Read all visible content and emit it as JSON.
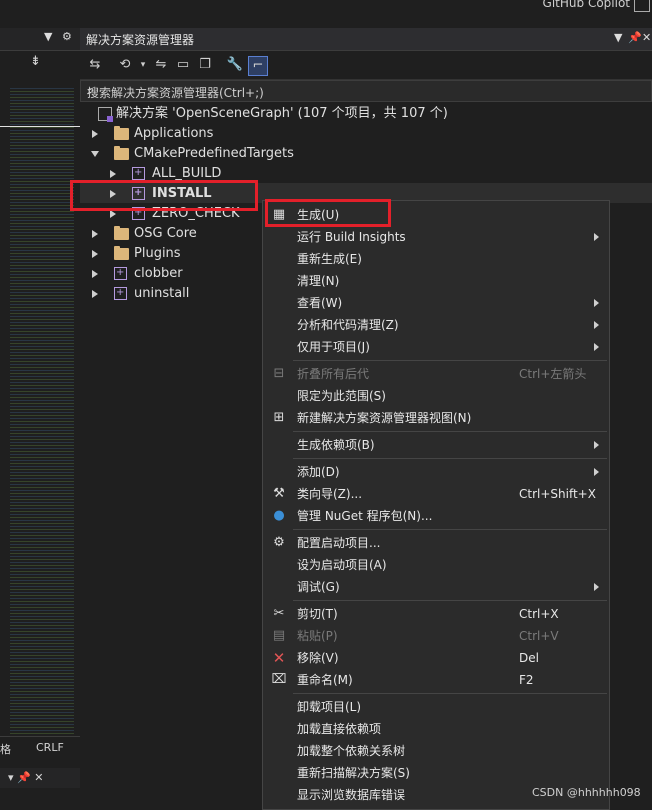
{
  "top": {
    "copilot": "GitHub Copilot"
  },
  "left_panel": {
    "pin_menu": "▼",
    "gear": "⚙",
    "nav_icon": "⇟",
    "status_left": "格",
    "line_ending": "CRLF",
    "bottom_controls": "▾ 📌 ✕"
  },
  "solution_explorer": {
    "title": "解决方案资源管理器",
    "title_controls": {
      "dropdown": "▼",
      "pin": "📌",
      "close": "✕"
    },
    "search_placeholder": "搜索解决方案资源管理器(Ctrl+;)",
    "tree": {
      "solution": "解决方案 'OpenSceneGraph' (107 个项目，共 107 个)",
      "applications": "Applications",
      "cmake_targets": "CMakePredefinedTargets",
      "all_build": "ALL_BUILD",
      "install": "INSTALL",
      "zero_check": "ZERO_CHECK",
      "osg_core": "OSG Core",
      "plugins": "Plugins",
      "clobber": "clobber",
      "uninstall": "uninstall"
    }
  },
  "context_menu": {
    "build": "生成(U)",
    "run_build_insights": "运行 Build Insights",
    "rebuild": "重新生成(E)",
    "clean": "清理(N)",
    "view": "查看(W)",
    "analyze": "分析和代码清理(Z)",
    "project_only": "仅用于项目(J)",
    "collapse_all": "折叠所有后代",
    "collapse_all_sc": "Ctrl+左箭头",
    "scope_to_this": "限定为此范围(S)",
    "new_view": "新建解决方案资源管理器视图(N)",
    "build_dependencies": "生成依赖项(B)",
    "add": "添加(D)",
    "class_wizard": "类向导(Z)...",
    "class_wizard_sc": "Ctrl+Shift+X",
    "manage_nuget": "管理 NuGet 程序包(N)...",
    "configure_startup": "配置启动项目...",
    "set_startup": "设为启动项目(A)",
    "debug": "调试(G)",
    "cut": "剪切(T)",
    "cut_sc": "Ctrl+X",
    "paste": "粘贴(P)",
    "paste_sc": "Ctrl+V",
    "remove": "移除(V)",
    "remove_sc": "Del",
    "rename": "重命名(M)",
    "rename_sc": "F2",
    "unload_project": "卸载项目(L)",
    "load_direct_deps": "加载直接依赖项",
    "load_all_deps": "加载整个依赖关系树",
    "rescan_solution": "重新扫描解决方案(S)",
    "show_db_errors": "显示浏览数据库错误"
  },
  "watermark": "CSDN @hhhhhh098",
  "colors": {
    "highlight": "#e3202a",
    "folder": "#dcb67a",
    "project": "#b59adf"
  }
}
